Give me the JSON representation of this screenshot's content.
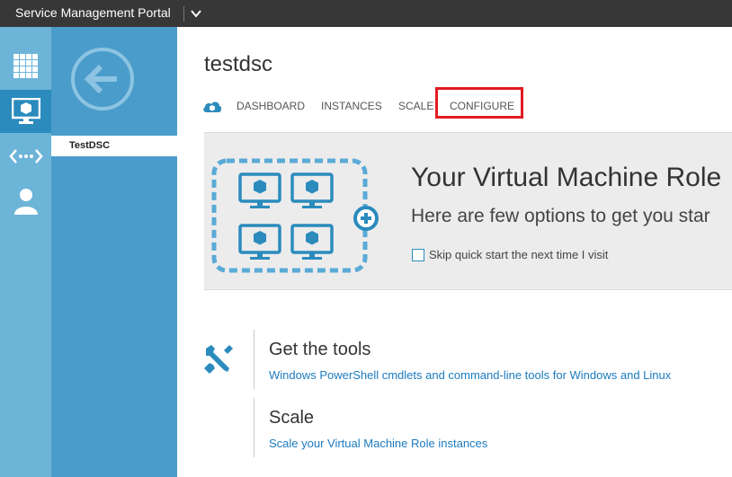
{
  "topbar": {
    "title": "Service Management Portal"
  },
  "rail": {
    "items": [
      {
        "icon": "grid-icon"
      },
      {
        "icon": "virtual-machine-icon"
      },
      {
        "icon": "network-icon"
      },
      {
        "icon": "user-icon"
      }
    ]
  },
  "nav": {
    "selected_item": "TestDSC"
  },
  "page": {
    "title": "testdsc",
    "tabs": {
      "dashboard": "DASHBOARD",
      "instances": "INSTANCES",
      "scale": "SCALE",
      "configure": "CONFIGURE"
    }
  },
  "quickstart": {
    "title": "Your Virtual Machine Role",
    "subtitle": "Here are few options to get you star",
    "checkbox_label": "Skip quick start the next time I visit"
  },
  "sections": {
    "tools": {
      "title": "Get the tools",
      "link": "Windows PowerShell cmdlets and command-line tools for Windows and Linux"
    },
    "scale": {
      "title": "Scale",
      "link": "Scale your Virtual Machine Role instances"
    }
  },
  "colors": {
    "accent": "#2b8bbd",
    "rail": "#6cb4d8",
    "nav": "#4a9ccb",
    "highlight": "#e21b23",
    "link": "#1c7bbf"
  }
}
